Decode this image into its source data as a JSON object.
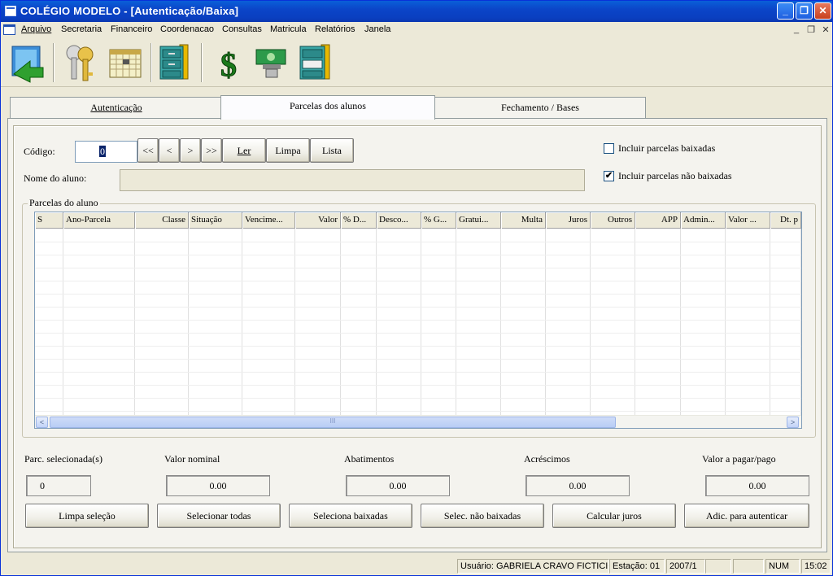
{
  "window": {
    "title": "COLÉGIO MODELO - [Autenticação/Baixa]",
    "minimize": "_",
    "maximize": "❐",
    "close": "✕"
  },
  "menu": [
    "Arquivo",
    "Secretaria",
    "Financeiro",
    "Coordenacao",
    "Consultas",
    "Matricula",
    "Relatórios",
    "Janela"
  ],
  "mdi_controls": [
    "_",
    "❐",
    "✕"
  ],
  "toolbar": {
    "icons": [
      "exit-icon",
      "keys-icon",
      "calendar-icon",
      "file-cabinet-icon",
      "dollar-icon",
      "money-icon",
      "file-cabinet-open-icon"
    ],
    "dollar_glyph": "$"
  },
  "tabs": [
    {
      "label": "Autenticação"
    },
    {
      "label": "Parcelas dos alunos"
    },
    {
      "label": "Fechamento / Bases"
    }
  ],
  "form": {
    "codigo_label": "Código:",
    "codigo_value": "0",
    "nav": [
      "<<",
      "<",
      ">",
      ">>"
    ],
    "ler": "Ler",
    "limpa": "Limpa",
    "lista": "Lista",
    "nome_label": "Nome do aluno:",
    "nome_value": "",
    "incluir_baixadas": "Incluir parcelas baixadas",
    "incluir_baixadas_checked": false,
    "incluir_nao_baixadas": "Incluir parcelas não baixadas",
    "incluir_nao_baixadas_checked": true,
    "check_mark": "✔"
  },
  "grid": {
    "title": "Parcelas do aluno",
    "columns": [
      "S",
      "Ano-Parcela",
      "Classe",
      "Situação",
      "Vencime...",
      "Valor",
      "% D...",
      "Desco...",
      "% G...",
      "Gratui...",
      "Multa",
      "Juros",
      "Outros",
      "APP",
      "Admin...",
      "Valor ...",
      "Dt. p"
    ],
    "rows": [],
    "scroll_left": "<",
    "scroll_right": ">",
    "scroll_grip": "III"
  },
  "summary": {
    "parc_label": "Parc. selecionada(s)",
    "parc_value": "0",
    "nominal_label": "Valor nominal",
    "nominal_value": "0.00",
    "abat_label": "Abatimentos",
    "abat_value": "0.00",
    "acres_label": "Acréscimos",
    "acres_value": "0.00",
    "pagar_label": "Valor a pagar/pago",
    "pagar_value": "0.00"
  },
  "actions": [
    "Limpa seleção",
    "Selecionar todas",
    "Seleciona baixadas",
    "Selec. não baixadas",
    "Calcular juros",
    "Adic. para autenticar"
  ],
  "status": {
    "usuario": "Usuário: GABRIELA CRAVO FICTICIO",
    "estacao": "Estação: 01",
    "periodo": "2007/1",
    "blank1": "",
    "blank2": "",
    "num": "NUM",
    "time": "15:02"
  }
}
